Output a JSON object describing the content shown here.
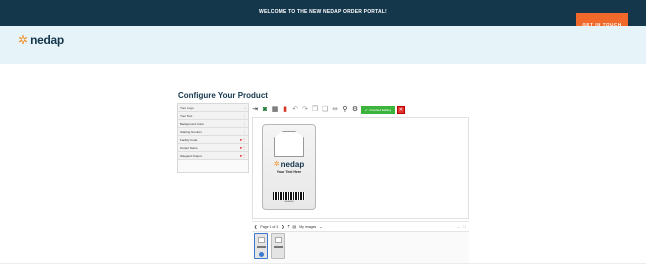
{
  "header": {
    "welcome": "WELCOME TO THE NEW NEDAP ORDER PORTAL!",
    "cta_label": "GET IN TOUCH",
    "brand": "nedap"
  },
  "page": {
    "title": "Configure Your Product"
  },
  "sidebar": {
    "items": [
      {
        "label": "Your Logo",
        "marker": "home"
      },
      {
        "label": "Your Text",
        "marker": "⋮"
      },
      {
        "label": "Background Color",
        "marker": "⋮"
      },
      {
        "label": "Starting Number",
        "marker": "⋮"
      },
      {
        "label": "Facility Code",
        "marker": "required"
      },
      {
        "label": "Output Name",
        "marker": "required"
      },
      {
        "label": "Wiegand Output",
        "marker": "required"
      }
    ]
  },
  "toolbar": {
    "icons": [
      "login-icon",
      "camera-icon",
      "qr-icon",
      "delete-icon",
      "undo-icon",
      "redo-icon",
      "copy-icon",
      "paste-icon",
      "align-icon",
      "zoom-icon",
      "settings-icon"
    ],
    "finish_label": "Finished Editing",
    "colors": {
      "finish": "#3cb43c",
      "close": "#e03030"
    }
  },
  "card": {
    "brand": "nedap",
    "text": "Your Text Here",
    "barcode_number": "00000000"
  },
  "pager": {
    "page_label": "Page 1 of 2",
    "images_label": "My Images"
  },
  "colors": {
    "topbar": "#14374c",
    "cta": "#f0682a",
    "hero": "#e6f4fa",
    "accent_star": "#f0902a"
  }
}
